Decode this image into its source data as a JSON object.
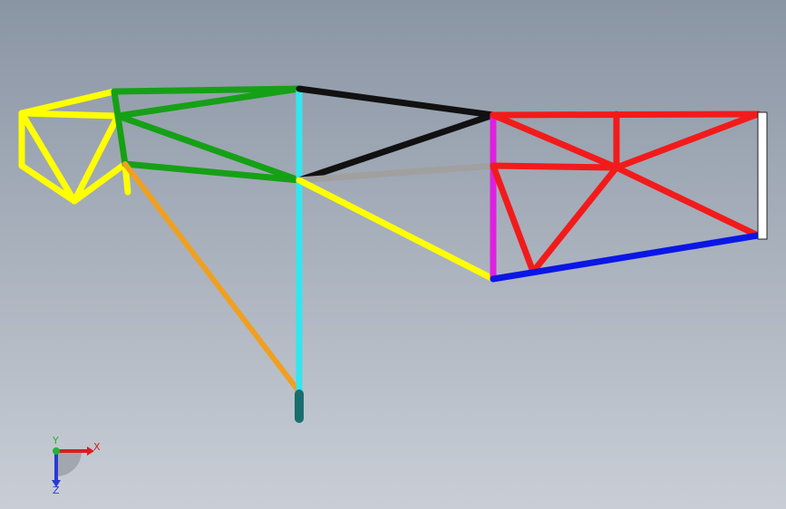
{
  "viewport": {
    "background_top": "#8a95a4",
    "background_bottom": "#c9ced6"
  },
  "triad": {
    "x_label": "X",
    "y_label": "Y",
    "z_label": "Z",
    "x_color": "#d81e1e",
    "y_color": "#22b43a",
    "z_color": "#2a3ad8"
  },
  "members": [
    {
      "id": "yellow-left-top",
      "color": "#ffff00"
    },
    {
      "id": "yellow-left-mid",
      "color": "#ffff00"
    },
    {
      "id": "yellow-left-vert",
      "color": "#ffff00"
    },
    {
      "id": "yellow-left-diag",
      "color": "#ffff00"
    },
    {
      "id": "yellow-left-bottom",
      "color": "#ffff00"
    },
    {
      "id": "yellow-left-diag2",
      "color": "#ffff00"
    },
    {
      "id": "yellow-left-diag3",
      "color": "#ffff00"
    },
    {
      "id": "yellow-left-diag4",
      "color": "#ffff00"
    },
    {
      "id": "yellow-left-stub",
      "color": "#ffff00"
    },
    {
      "id": "green-top",
      "color": "#16a016"
    },
    {
      "id": "green-mid",
      "color": "#16a016"
    },
    {
      "id": "green-diag",
      "color": "#16a016"
    },
    {
      "id": "green-bottom",
      "color": "#16a016"
    },
    {
      "id": "green-vert",
      "color": "#16a016"
    },
    {
      "id": "black-top",
      "color": "#111111"
    },
    {
      "id": "black-diag",
      "color": "#111111"
    },
    {
      "id": "gray-mid",
      "color": "#a0a0a0"
    },
    {
      "id": "yellow-lower",
      "color": "#ffff00"
    },
    {
      "id": "cyan-column",
      "color": "#33e6f0"
    },
    {
      "id": "orange-brace",
      "color": "#f0a020"
    },
    {
      "id": "magenta-vert",
      "color": "#e020e0"
    },
    {
      "id": "red-top",
      "color": "#f21b1b"
    },
    {
      "id": "red-mid",
      "color": "#f21b1b"
    },
    {
      "id": "red-vert",
      "color": "#f21b1b"
    },
    {
      "id": "red-diag1",
      "color": "#f21b1b"
    },
    {
      "id": "red-diag2",
      "color": "#f21b1b"
    },
    {
      "id": "red-diag3",
      "color": "#f21b1b"
    },
    {
      "id": "red-diag4",
      "color": "#f21b1b"
    },
    {
      "id": "red-left-vert",
      "color": "#f21b1b"
    },
    {
      "id": "blue-bottom",
      "color": "#0a16e6"
    },
    {
      "id": "white-end",
      "color": "#ffffff"
    }
  ]
}
